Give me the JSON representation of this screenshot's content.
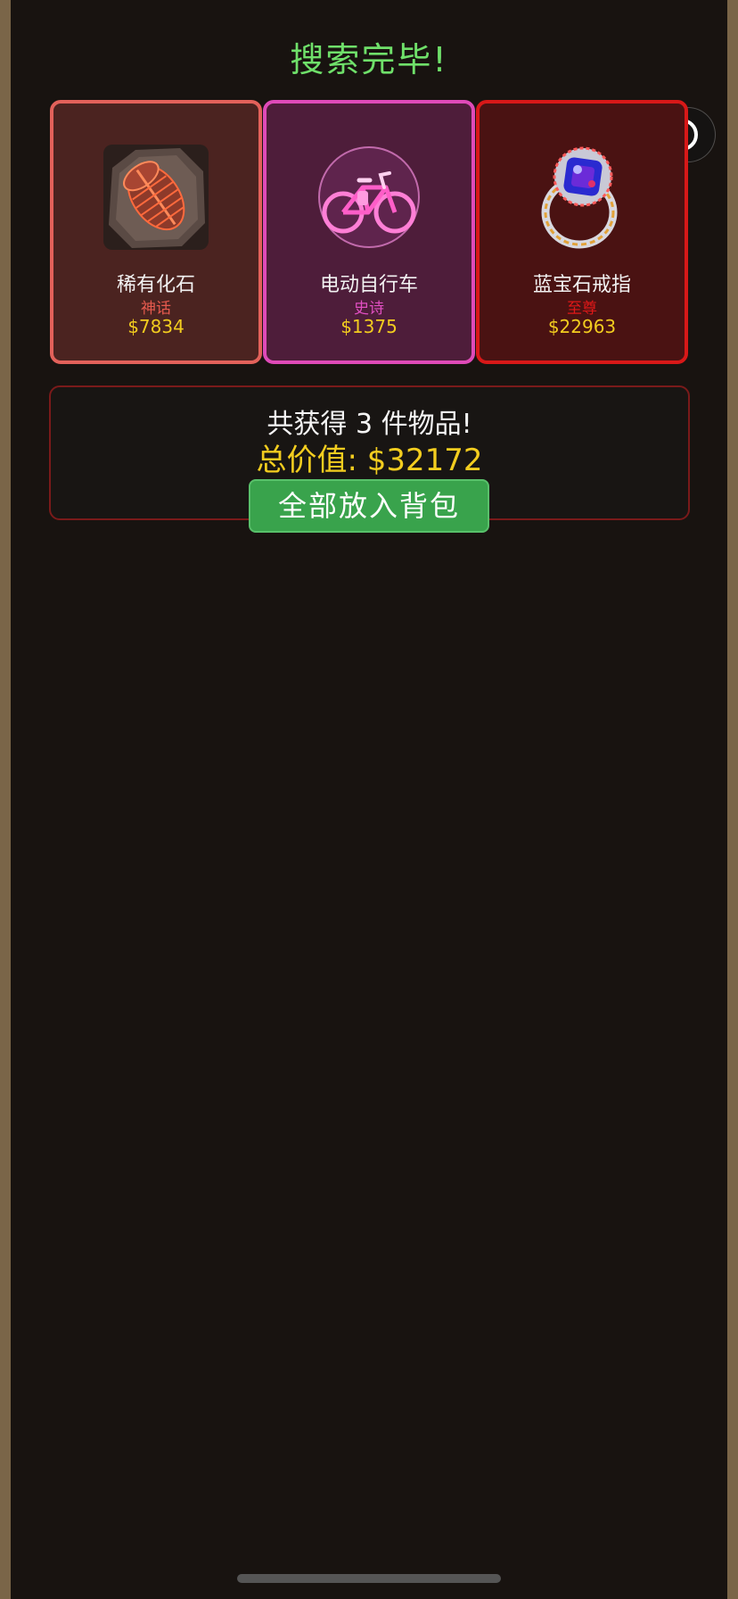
{
  "header": {
    "title": "搜索完毕!"
  },
  "capsule": {
    "more_icon": "more-dots-icon",
    "close_icon": "target-close-icon"
  },
  "items": [
    {
      "name": "稀有化石",
      "rarity": "神话",
      "price": "$7834",
      "rarity_color": "#e65a4e",
      "icon": "trilobite-fossil-icon"
    },
    {
      "name": "电动自行车",
      "rarity": "史诗",
      "price": "$1375",
      "rarity_color": "#e14fc2",
      "icon": "electric-bicycle-icon"
    },
    {
      "name": "蓝宝石戒指",
      "rarity": "至尊",
      "price": "$22963",
      "rarity_color": "#e01818",
      "icon": "sapphire-ring-icon"
    }
  ],
  "summary": {
    "count_text": "共获得 3 件物品!",
    "total_text": "总价值: $32172",
    "store_all_label": "全部放入背包"
  },
  "colors": {
    "title": "#6fe06a",
    "price": "#f2cc1f",
    "button": "#39a34c"
  }
}
